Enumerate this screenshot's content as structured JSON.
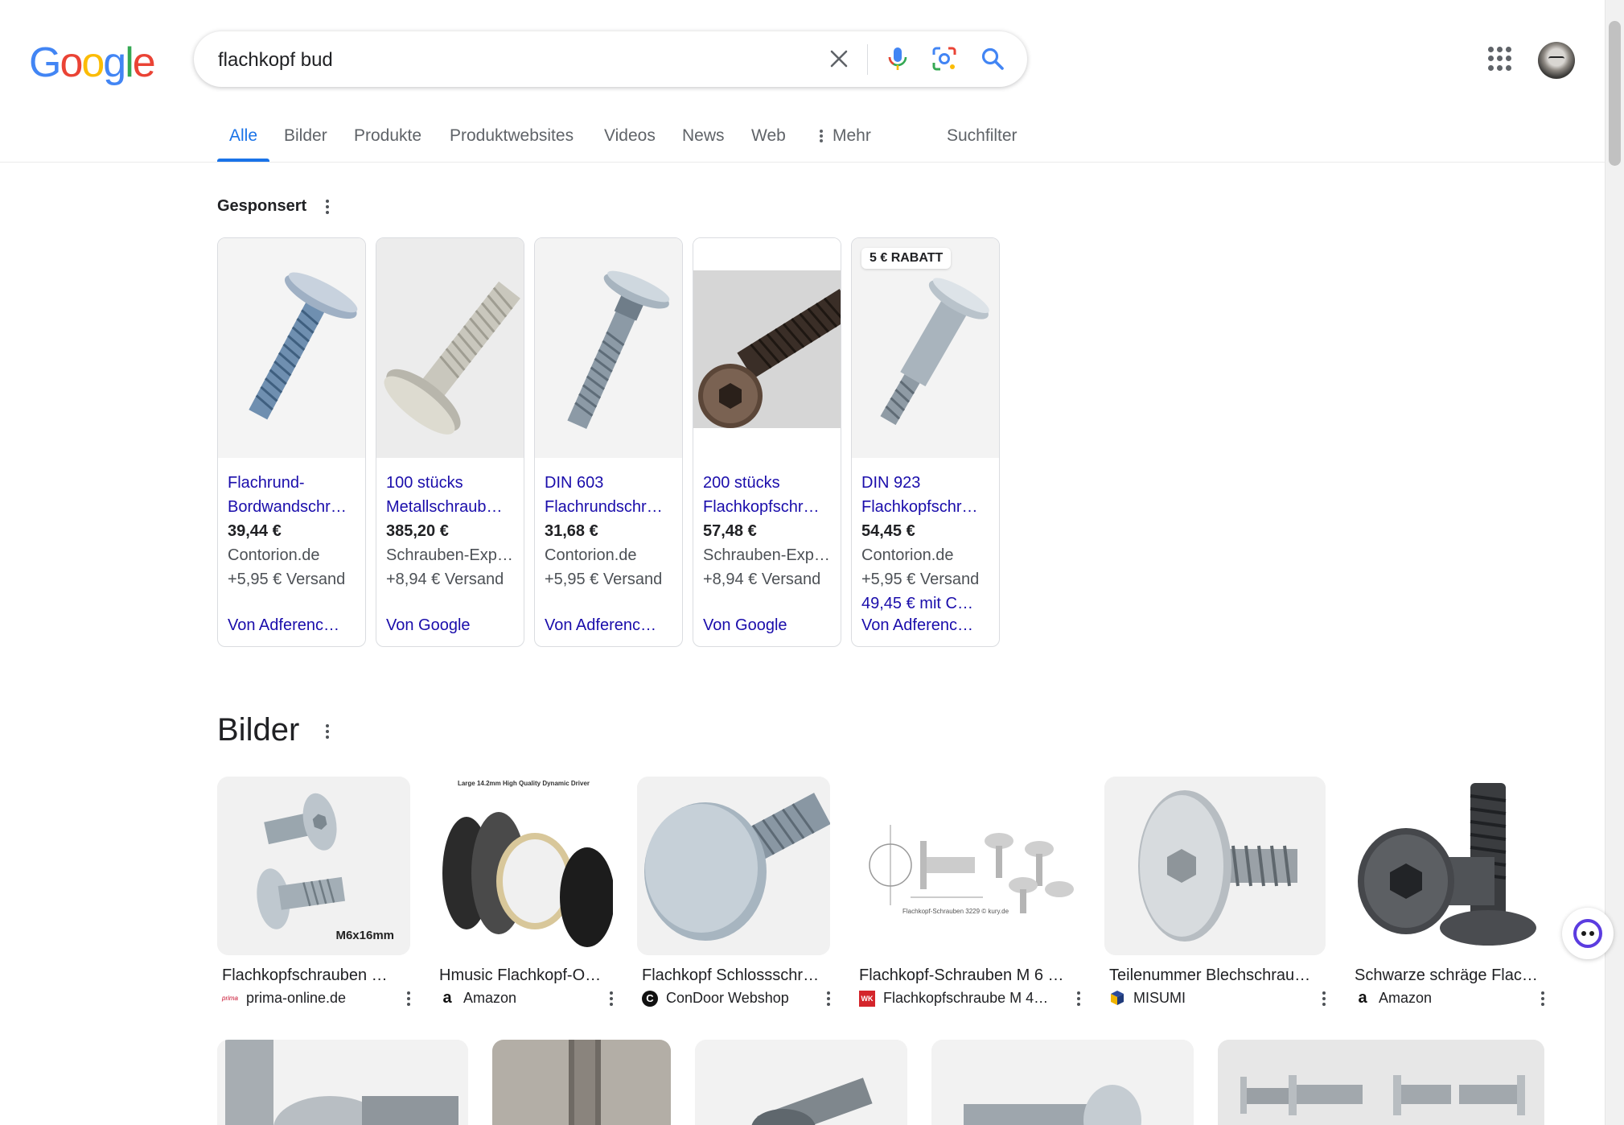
{
  "logo": {
    "letters": [
      "G",
      "o",
      "o",
      "g",
      "l",
      "e"
    ],
    "colors": [
      "#4285F4",
      "#EA4335",
      "#FBBC05",
      "#4285F4",
      "#34A853",
      "#EA4335"
    ]
  },
  "search": {
    "query": "flachkopf bud"
  },
  "tabs": [
    {
      "label": "Alle"
    },
    {
      "label": "Bilder"
    },
    {
      "label": "Produkte"
    },
    {
      "label": "Produktwebsites"
    },
    {
      "label": "Videos"
    },
    {
      "label": "News"
    },
    {
      "label": "Web"
    },
    {
      "label": "Mehr"
    },
    {
      "label": "Suchfilter"
    }
  ],
  "sponsored": {
    "heading": "Gesponsert",
    "products": [
      {
        "title": "Flachrund-Bordwandschr…",
        "price": "39,44 €",
        "merchant": "Contorion.de",
        "shipping": "+5,95 € Versand",
        "offer": "",
        "via": "Von Adferenc…",
        "badge": ""
      },
      {
        "title": "100 stücks Metallschraub…",
        "price": "385,20 €",
        "merchant": "Schrauben-Exp…",
        "shipping": "+8,94 € Versand",
        "offer": "",
        "via": "Von Google",
        "badge": ""
      },
      {
        "title": "DIN 603 Flachrundschr…",
        "price": "31,68 €",
        "merchant": "Contorion.de",
        "shipping": "+5,95 € Versand",
        "offer": "",
        "via": "Von Adferenc…",
        "badge": ""
      },
      {
        "title": "200 stücks Flachkopfschr…",
        "price": "57,48 €",
        "merchant": "Schrauben-Exp…",
        "shipping": "+8,94 € Versand",
        "offer": "",
        "via": "Von Google",
        "badge": ""
      },
      {
        "title": "DIN 923 Flachkopfschr…",
        "price": "54,45 €",
        "merchant": "Contorion.de",
        "shipping": "+5,95 € Versand",
        "offer": "49,45 € mit C…",
        "via": "Von Adferenc…",
        "badge": "5 € RABATT"
      }
    ]
  },
  "images": {
    "heading": "Bilder",
    "items": [
      {
        "title": "Flachkopfschrauben …",
        "source": "prima-online.de",
        "favicon_text": "prima",
        "image_caption": "M6x16mm"
      },
      {
        "title": "Hmusic Flachkopf-O…",
        "source": "Amazon",
        "favicon_text": "a",
        "image_caption": "Large 14.2mm High Quality Dynamic Driver"
      },
      {
        "title": "Flachkopf Schlossschr…",
        "source": "ConDoor Webshop",
        "favicon_text": "C",
        "image_caption": ""
      },
      {
        "title": "Flachkopf-Schrauben M 6 …",
        "source": "Flachkopfschraube M 4…",
        "favicon_text": "WK",
        "image_caption": "Flachkopf-Schrauben 3229 © kury.de"
      },
      {
        "title": "Teilenummer Blechschrau…",
        "source": "MISUMI",
        "favicon_text": "",
        "image_caption": ""
      },
      {
        "title": "Schwarze schräge Flac…",
        "source": "Amazon",
        "favicon_text": "a",
        "image_caption": ""
      }
    ]
  }
}
